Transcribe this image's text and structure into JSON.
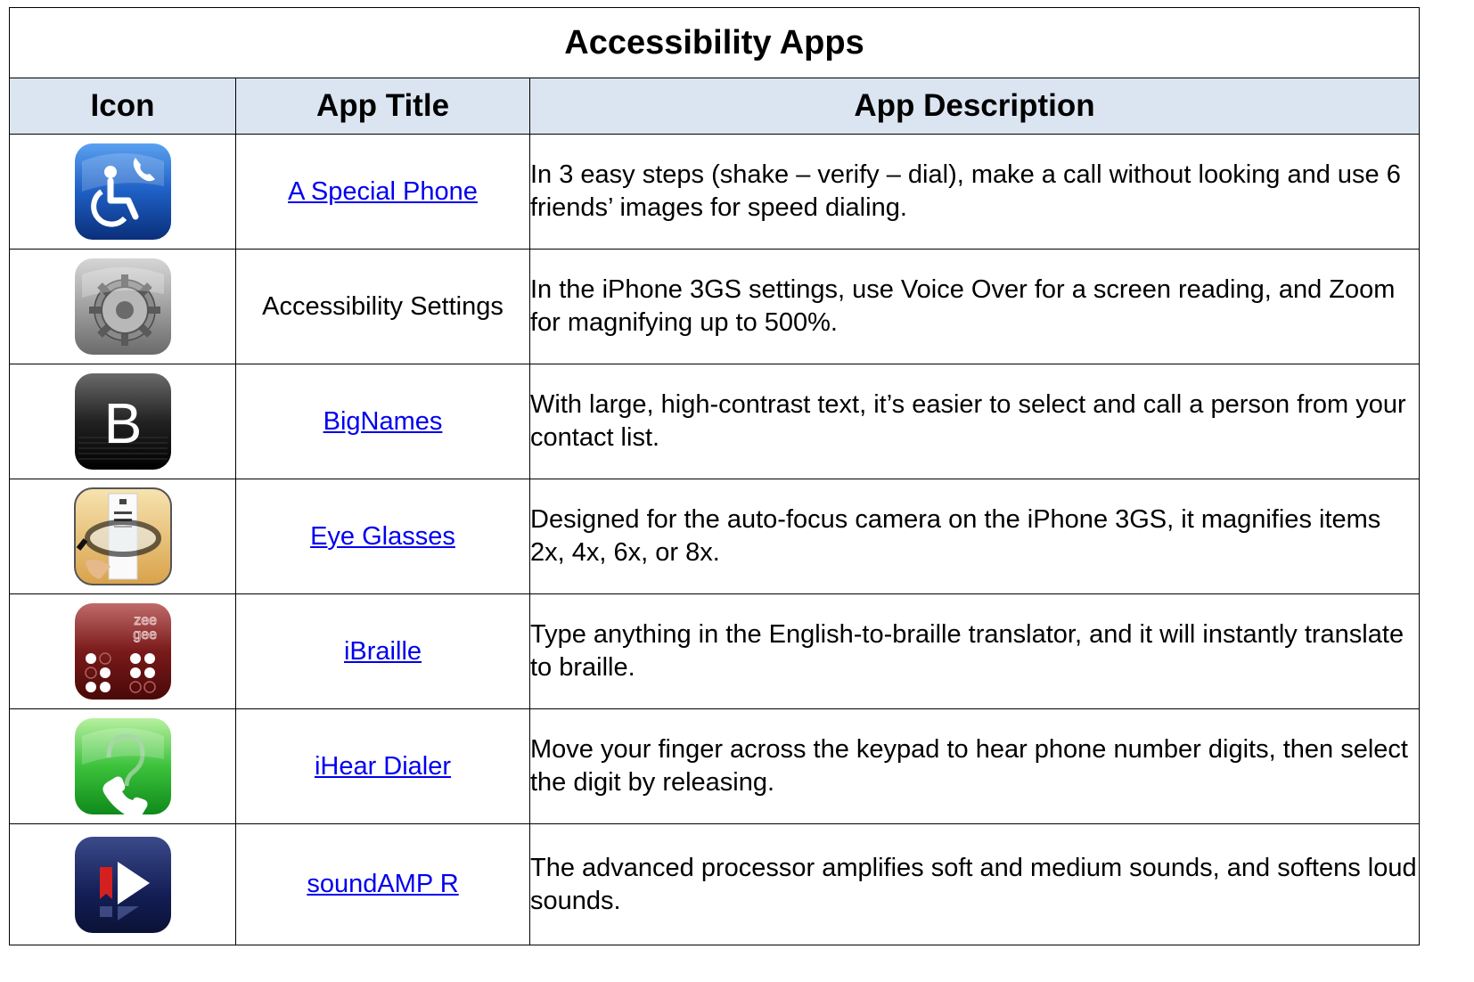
{
  "table": {
    "title": "Accessibility Apps",
    "headers": {
      "icon": "Icon",
      "title": "App Title",
      "description": "App Description"
    },
    "rows": [
      {
        "icon": "special-phone-icon",
        "title": "A Special Phone",
        "linked": true,
        "description": "In 3 easy steps (shake – verify – dial), make a call without looking and use 6 friends’ images for speed dialing."
      },
      {
        "icon": "settings-gear-icon",
        "title": "Accessibility Settings",
        "linked": false,
        "description": "In the iPhone 3GS settings, use Voice Over for a screen reading, and Zoom for magnifying up to 500%."
      },
      {
        "icon": "bignames-b-icon",
        "title": "BigNames",
        "linked": true,
        "description": "With large, high-contrast text, it’s easier to select and call a person from your contact list."
      },
      {
        "icon": "eye-glasses-icon",
        "title": "Eye Glasses",
        "linked": true,
        "description": "Designed for the auto-focus camera on the iPhone 3GS, it magnifies items 2x, 4x, 6x, or 8x."
      },
      {
        "icon": "ibraille-icon",
        "title": "iBraille",
        "linked": true,
        "icon_text": "zee gee",
        "description": "Type anything in the English-to-braille translator, and it will instantly translate to braille."
      },
      {
        "icon": "ihear-dialer-icon",
        "title": "iHear Dialer",
        "linked": true,
        "description": "Move your finger across the keypad to hear phone number digits, then select the digit by releasing."
      },
      {
        "icon": "soundamp-icon",
        "title": "soundAMP R",
        "linked": true,
        "description": "The advanced processor amplifies soft and medium sounds, and softens loud sounds."
      }
    ]
  },
  "colors": {
    "header_bg": "#dbe5f1",
    "link": "#0000ee",
    "border": "#000000"
  }
}
